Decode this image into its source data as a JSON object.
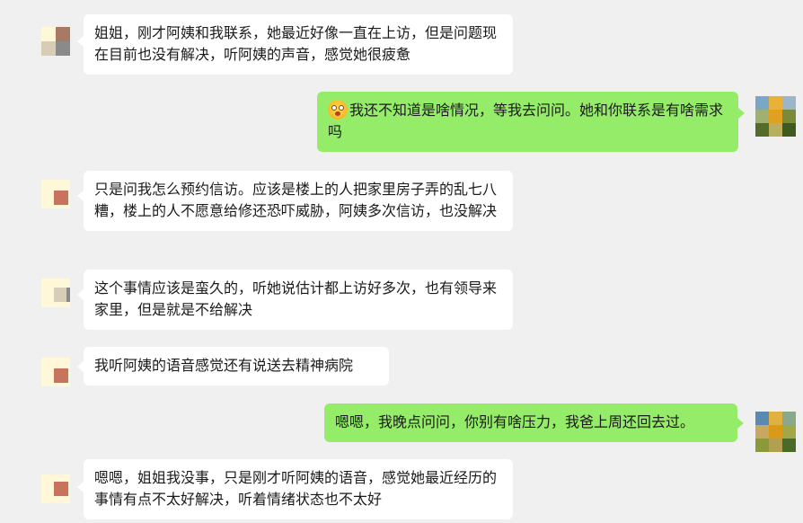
{
  "chat": {
    "messages": [
      {
        "side": "left",
        "text": "姐姐，刚才阿姨和我联系，她最近好像一直在上访，但是问题现在目前也没有解决，听阿姨的声音，感觉她很疲惫"
      },
      {
        "side": "right",
        "emoji": "shocked-face-emoji",
        "text": "我还不知道是啥情况，等我去问问。她和你联系是有啥需求吗"
      },
      {
        "side": "left",
        "text": "只是问我怎么预约信访。应该是楼上的人把家里房子弄的乱七八糟，楼上的人不愿意给修还恐吓威胁，阿姨多次信访，也没解决"
      },
      {
        "side": "left",
        "text": "这个事情应该是蛮久的，听她说估计都上访好多次，也有领导来家里，但是就是不给解决"
      },
      {
        "side": "left",
        "text": "我听阿姨的语音感觉还有说送去精神病院"
      },
      {
        "side": "right",
        "text": "嗯嗯，我晚点问问，你别有啥压力，我爸上周还回去过。"
      },
      {
        "side": "left",
        "text": "嗯嗯，姐姐我没事，只是刚才听阿姨的语音，感觉她最近经历的事情有点不太好解决，听着情绪状态也不太好"
      }
    ]
  },
  "colors": {
    "background": "#f0f0f0",
    "bubble_left": "#ffffff",
    "bubble_right": "#95ec69"
  }
}
